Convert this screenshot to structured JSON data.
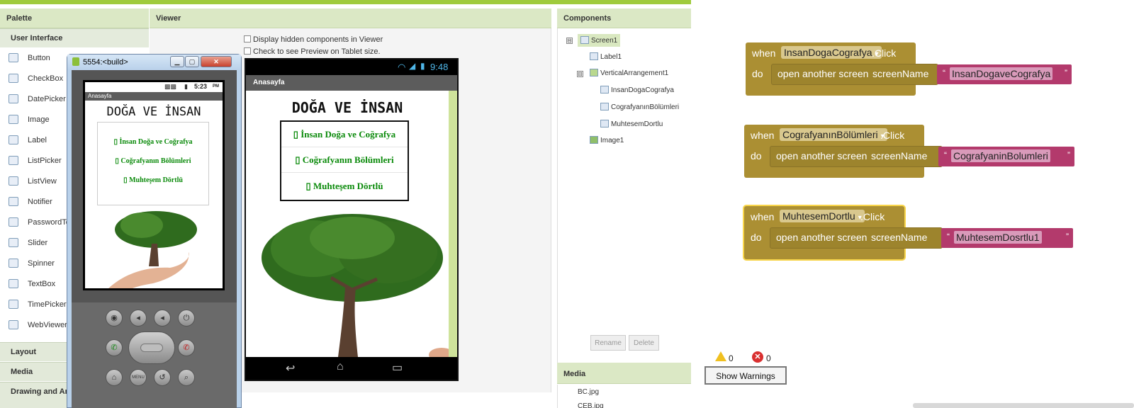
{
  "panels": {
    "palette": "Palette",
    "viewer": "Viewer",
    "components": "Components",
    "media": "Media"
  },
  "palette": {
    "section_open": "User Interface",
    "items": [
      {
        "label": "Button",
        "icon": "button-icon"
      },
      {
        "label": "CheckBox",
        "icon": "checkbox-icon"
      },
      {
        "label": "DatePicker",
        "icon": "datepicker-icon"
      },
      {
        "label": "Image",
        "icon": "image-icon"
      },
      {
        "label": "Label",
        "icon": "label-icon"
      },
      {
        "label": "ListPicker",
        "icon": "listpicker-icon"
      },
      {
        "label": "ListView",
        "icon": "listview-icon"
      },
      {
        "label": "Notifier",
        "icon": "notifier-icon"
      },
      {
        "label": "PasswordTe",
        "icon": "password-icon"
      },
      {
        "label": "Slider",
        "icon": "slider-icon"
      },
      {
        "label": "Spinner",
        "icon": "spinner-icon"
      },
      {
        "label": "TextBox",
        "icon": "textbox-icon"
      },
      {
        "label": "TimePicker",
        "icon": "timepicker-icon"
      },
      {
        "label": "WebViewer",
        "icon": "webviewer-icon"
      }
    ],
    "sections": [
      "Layout",
      "Media",
      "Drawing and An"
    ]
  },
  "viewer": {
    "show_hidden": "Display hidden components in Viewer",
    "tablet_preview": "Check to see Preview on Tablet size.",
    "status_time": "9:48",
    "screen_title": "Anasayfa",
    "heading": "DOĞA VE İNSAN",
    "buttons": [
      "İnsan Doğa ve Coğrafya",
      "Coğrafyanın Bölümleri",
      "Muhteşem Dörtlü"
    ],
    "button_glyph": "▯"
  },
  "emulator": {
    "window_title": "5554:<build>",
    "status_time": "5:23",
    "status_suffix": "PM",
    "screen_title": "Anasayfa",
    "heading": "DOĞA VE İNSAN",
    "buttons": [
      "İnsan Doğa ve Coğrafya",
      "Coğrafyanın Bölümleri",
      "Muhteşem Dörtlü"
    ],
    "menu_key": "MENU"
  },
  "components": {
    "tree": [
      {
        "label": "Screen1",
        "toggle": "⊟"
      },
      {
        "label": "Label1"
      },
      {
        "label": "VerticalArrangement1",
        "toggle": "⊟"
      },
      {
        "label": "InsanDogaCografya"
      },
      {
        "label": "CografyanınBölümleri"
      },
      {
        "label": "MuhtesemDortlu"
      },
      {
        "label": "Image1"
      }
    ],
    "rename": "Rename",
    "delete": "Delete"
  },
  "media": {
    "files": [
      "BC.jpg",
      "CEB.jpg"
    ]
  },
  "blocks": [
    {
      "when": "when",
      "component": "InsanDogaCografya",
      "event": ".Click",
      "do": "do",
      "action": "open another screen",
      "param": "screenName",
      "value": "InsanDogaveCografya"
    },
    {
      "when": "when",
      "component": "CografyanınBölümleri",
      "event": ".Click",
      "do": "do",
      "action": "open another screen",
      "param": "screenName",
      "value": "CografyaninBolumleri"
    },
    {
      "when": "when",
      "component": "MuhtesemDortlu",
      "event": ".Click",
      "do": "do",
      "action": "open another screen",
      "param": "screenName",
      "value": "MuhtesemDosrtlu1"
    }
  ],
  "warnings": {
    "warn_count": "0",
    "error_count": "0",
    "show_warnings": "Show Warnings"
  },
  "colors": {
    "accent": "#9fcb3c",
    "event_block": "#ab8f33",
    "string_block": "#b33a6c",
    "button_text": "#0a8a0a"
  }
}
